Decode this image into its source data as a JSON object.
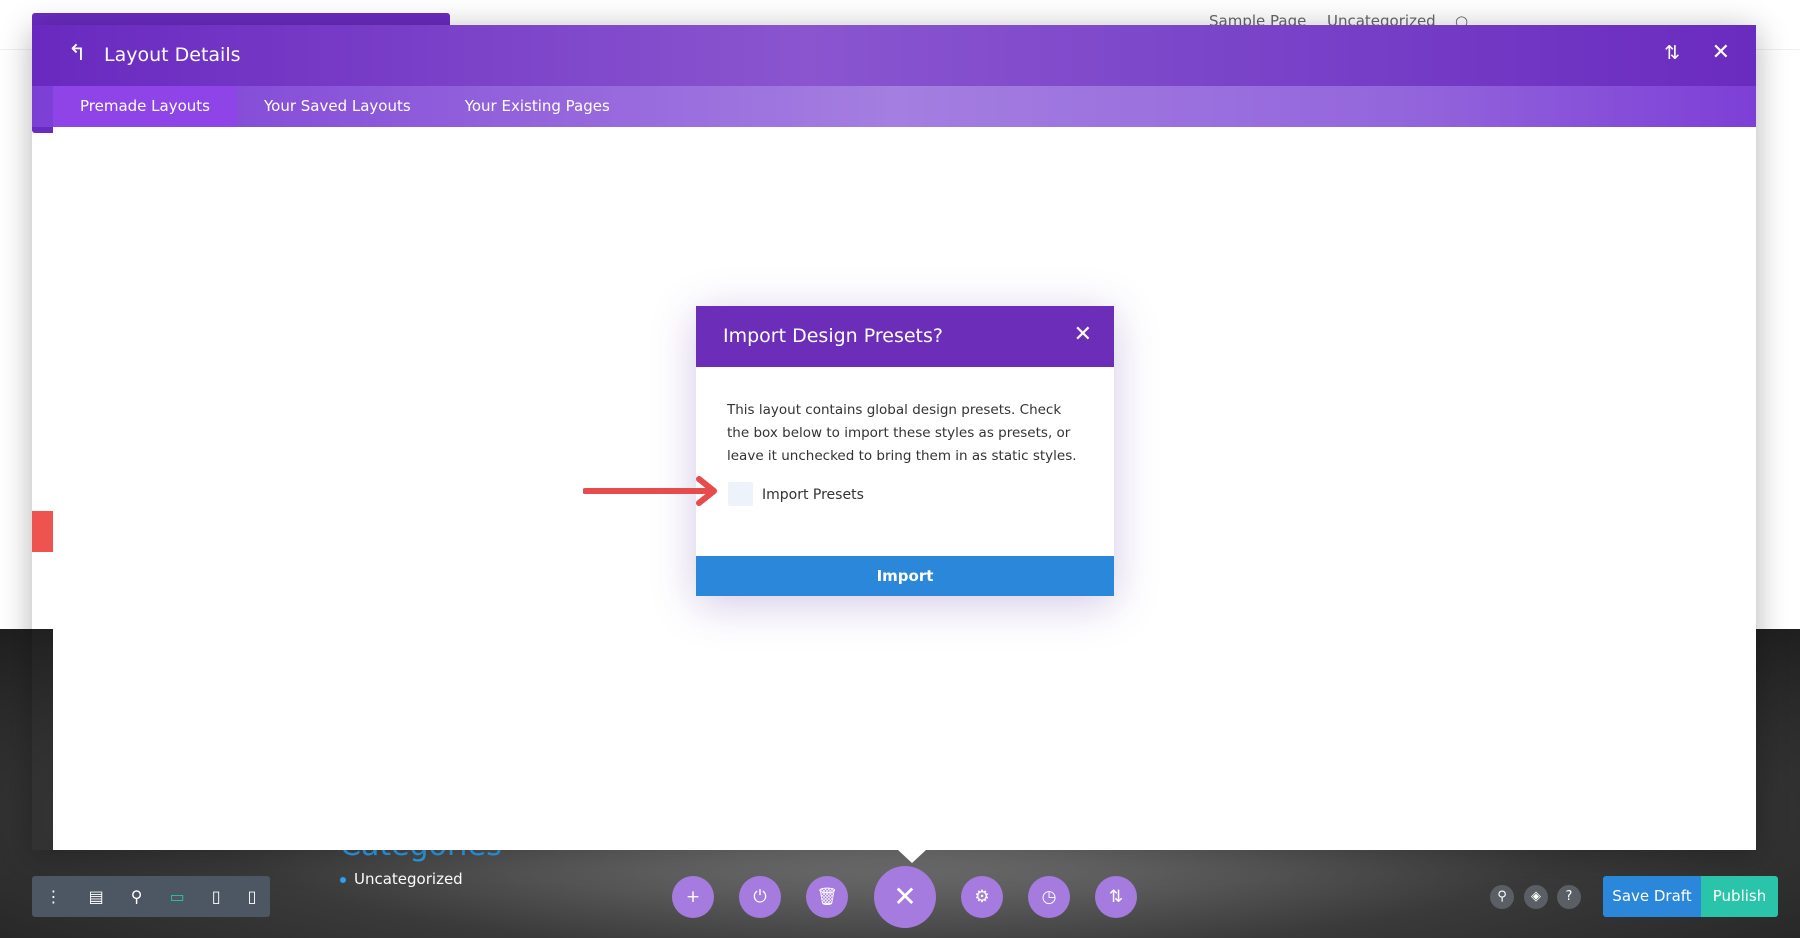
{
  "topnav": {
    "items": [
      "Sample Page",
      "Uncategorized"
    ]
  },
  "background": {
    "categories_title": "Categories",
    "category_item": "Uncategorized"
  },
  "modal": {
    "title": "Layout Details",
    "tabs": [
      {
        "label": "Premade Layouts",
        "active": true
      },
      {
        "label": "Your Saved Layouts"
      },
      {
        "label": "Your Existing Pages"
      }
    ]
  },
  "dialog": {
    "title": "Import Design Presets?",
    "text": "This layout contains global design presets. Check the box below to import these styles as presets, or leave it unchecked to bring them in as static styles.",
    "checkbox_label": "Import Presets",
    "checkbox_checked": false,
    "button": "Import"
  },
  "footer": {
    "save_draft": "Save Draft",
    "publish": "Publish"
  },
  "colors": {
    "purple": "#6c2eb9",
    "blue": "#2b87da",
    "green": "#29c4a9",
    "arrow": "#e74c4c"
  }
}
